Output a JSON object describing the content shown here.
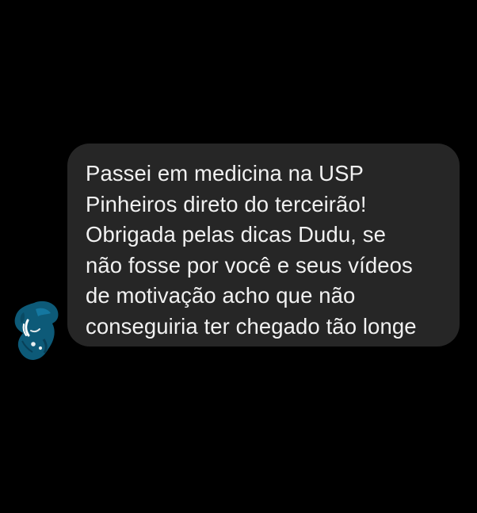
{
  "conversation": {
    "message": {
      "sender_avatar_icon": "profile-avatar-icon",
      "lines": [
        "Passei em medicina na USP",
        "Pinheiros direto do terceirão!",
        "Obrigada pelas dicas Dudu, se",
        "não fosse por você e seus vídeos",
        "de motivação acho que não",
        "conseguiria ter chegado tão longe"
      ]
    }
  },
  "colors": {
    "background": "#000000",
    "bubble": "#262626",
    "text": "#f1f1f1",
    "avatar_primary": "#0d5a78"
  }
}
